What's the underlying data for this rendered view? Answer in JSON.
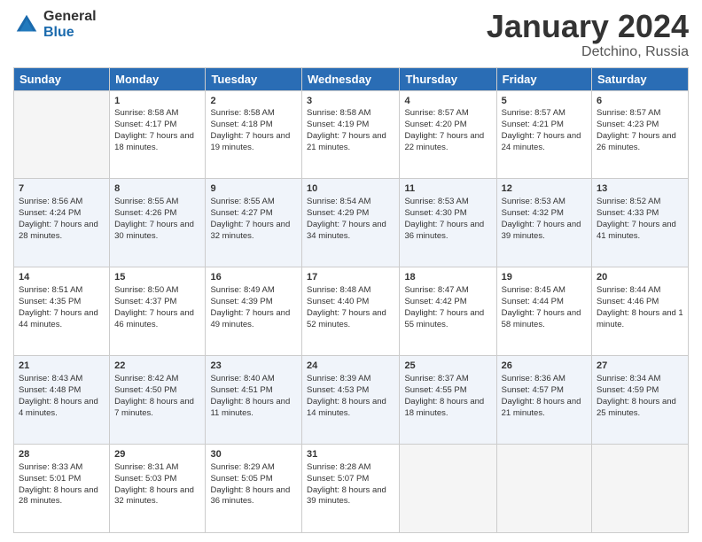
{
  "logo": {
    "general": "General",
    "blue": "Blue"
  },
  "header": {
    "month": "January 2024",
    "location": "Detchino, Russia"
  },
  "days": [
    "Sunday",
    "Monday",
    "Tuesday",
    "Wednesday",
    "Thursday",
    "Friday",
    "Saturday"
  ],
  "weeks": [
    [
      {
        "day": "",
        "sunrise": "",
        "sunset": "",
        "daylight": ""
      },
      {
        "day": "1",
        "sunrise": "Sunrise: 8:58 AM",
        "sunset": "Sunset: 4:17 PM",
        "daylight": "Daylight: 7 hours and 18 minutes."
      },
      {
        "day": "2",
        "sunrise": "Sunrise: 8:58 AM",
        "sunset": "Sunset: 4:18 PM",
        "daylight": "Daylight: 7 hours and 19 minutes."
      },
      {
        "day": "3",
        "sunrise": "Sunrise: 8:58 AM",
        "sunset": "Sunset: 4:19 PM",
        "daylight": "Daylight: 7 hours and 21 minutes."
      },
      {
        "day": "4",
        "sunrise": "Sunrise: 8:57 AM",
        "sunset": "Sunset: 4:20 PM",
        "daylight": "Daylight: 7 hours and 22 minutes."
      },
      {
        "day": "5",
        "sunrise": "Sunrise: 8:57 AM",
        "sunset": "Sunset: 4:21 PM",
        "daylight": "Daylight: 7 hours and 24 minutes."
      },
      {
        "day": "6",
        "sunrise": "Sunrise: 8:57 AM",
        "sunset": "Sunset: 4:23 PM",
        "daylight": "Daylight: 7 hours and 26 minutes."
      }
    ],
    [
      {
        "day": "7",
        "sunrise": "Sunrise: 8:56 AM",
        "sunset": "Sunset: 4:24 PM",
        "daylight": "Daylight: 7 hours and 28 minutes."
      },
      {
        "day": "8",
        "sunrise": "Sunrise: 8:55 AM",
        "sunset": "Sunset: 4:26 PM",
        "daylight": "Daylight: 7 hours and 30 minutes."
      },
      {
        "day": "9",
        "sunrise": "Sunrise: 8:55 AM",
        "sunset": "Sunset: 4:27 PM",
        "daylight": "Daylight: 7 hours and 32 minutes."
      },
      {
        "day": "10",
        "sunrise": "Sunrise: 8:54 AM",
        "sunset": "Sunset: 4:29 PM",
        "daylight": "Daylight: 7 hours and 34 minutes."
      },
      {
        "day": "11",
        "sunrise": "Sunrise: 8:53 AM",
        "sunset": "Sunset: 4:30 PM",
        "daylight": "Daylight: 7 hours and 36 minutes."
      },
      {
        "day": "12",
        "sunrise": "Sunrise: 8:53 AM",
        "sunset": "Sunset: 4:32 PM",
        "daylight": "Daylight: 7 hours and 39 minutes."
      },
      {
        "day": "13",
        "sunrise": "Sunrise: 8:52 AM",
        "sunset": "Sunset: 4:33 PM",
        "daylight": "Daylight: 7 hours and 41 minutes."
      }
    ],
    [
      {
        "day": "14",
        "sunrise": "Sunrise: 8:51 AM",
        "sunset": "Sunset: 4:35 PM",
        "daylight": "Daylight: 7 hours and 44 minutes."
      },
      {
        "day": "15",
        "sunrise": "Sunrise: 8:50 AM",
        "sunset": "Sunset: 4:37 PM",
        "daylight": "Daylight: 7 hours and 46 minutes."
      },
      {
        "day": "16",
        "sunrise": "Sunrise: 8:49 AM",
        "sunset": "Sunset: 4:39 PM",
        "daylight": "Daylight: 7 hours and 49 minutes."
      },
      {
        "day": "17",
        "sunrise": "Sunrise: 8:48 AM",
        "sunset": "Sunset: 4:40 PM",
        "daylight": "Daylight: 7 hours and 52 minutes."
      },
      {
        "day": "18",
        "sunrise": "Sunrise: 8:47 AM",
        "sunset": "Sunset: 4:42 PM",
        "daylight": "Daylight: 7 hours and 55 minutes."
      },
      {
        "day": "19",
        "sunrise": "Sunrise: 8:45 AM",
        "sunset": "Sunset: 4:44 PM",
        "daylight": "Daylight: 7 hours and 58 minutes."
      },
      {
        "day": "20",
        "sunrise": "Sunrise: 8:44 AM",
        "sunset": "Sunset: 4:46 PM",
        "daylight": "Daylight: 8 hours and 1 minute."
      }
    ],
    [
      {
        "day": "21",
        "sunrise": "Sunrise: 8:43 AM",
        "sunset": "Sunset: 4:48 PM",
        "daylight": "Daylight: 8 hours and 4 minutes."
      },
      {
        "day": "22",
        "sunrise": "Sunrise: 8:42 AM",
        "sunset": "Sunset: 4:50 PM",
        "daylight": "Daylight: 8 hours and 7 minutes."
      },
      {
        "day": "23",
        "sunrise": "Sunrise: 8:40 AM",
        "sunset": "Sunset: 4:51 PM",
        "daylight": "Daylight: 8 hours and 11 minutes."
      },
      {
        "day": "24",
        "sunrise": "Sunrise: 8:39 AM",
        "sunset": "Sunset: 4:53 PM",
        "daylight": "Daylight: 8 hours and 14 minutes."
      },
      {
        "day": "25",
        "sunrise": "Sunrise: 8:37 AM",
        "sunset": "Sunset: 4:55 PM",
        "daylight": "Daylight: 8 hours and 18 minutes."
      },
      {
        "day": "26",
        "sunrise": "Sunrise: 8:36 AM",
        "sunset": "Sunset: 4:57 PM",
        "daylight": "Daylight: 8 hours and 21 minutes."
      },
      {
        "day": "27",
        "sunrise": "Sunrise: 8:34 AM",
        "sunset": "Sunset: 4:59 PM",
        "daylight": "Daylight: 8 hours and 25 minutes."
      }
    ],
    [
      {
        "day": "28",
        "sunrise": "Sunrise: 8:33 AM",
        "sunset": "Sunset: 5:01 PM",
        "daylight": "Daylight: 8 hours and 28 minutes."
      },
      {
        "day": "29",
        "sunrise": "Sunrise: 8:31 AM",
        "sunset": "Sunset: 5:03 PM",
        "daylight": "Daylight: 8 hours and 32 minutes."
      },
      {
        "day": "30",
        "sunrise": "Sunrise: 8:29 AM",
        "sunset": "Sunset: 5:05 PM",
        "daylight": "Daylight: 8 hours and 36 minutes."
      },
      {
        "day": "31",
        "sunrise": "Sunrise: 8:28 AM",
        "sunset": "Sunset: 5:07 PM",
        "daylight": "Daylight: 8 hours and 39 minutes."
      },
      {
        "day": "",
        "sunrise": "",
        "sunset": "",
        "daylight": ""
      },
      {
        "day": "",
        "sunrise": "",
        "sunset": "",
        "daylight": ""
      },
      {
        "day": "",
        "sunrise": "",
        "sunset": "",
        "daylight": ""
      }
    ]
  ]
}
